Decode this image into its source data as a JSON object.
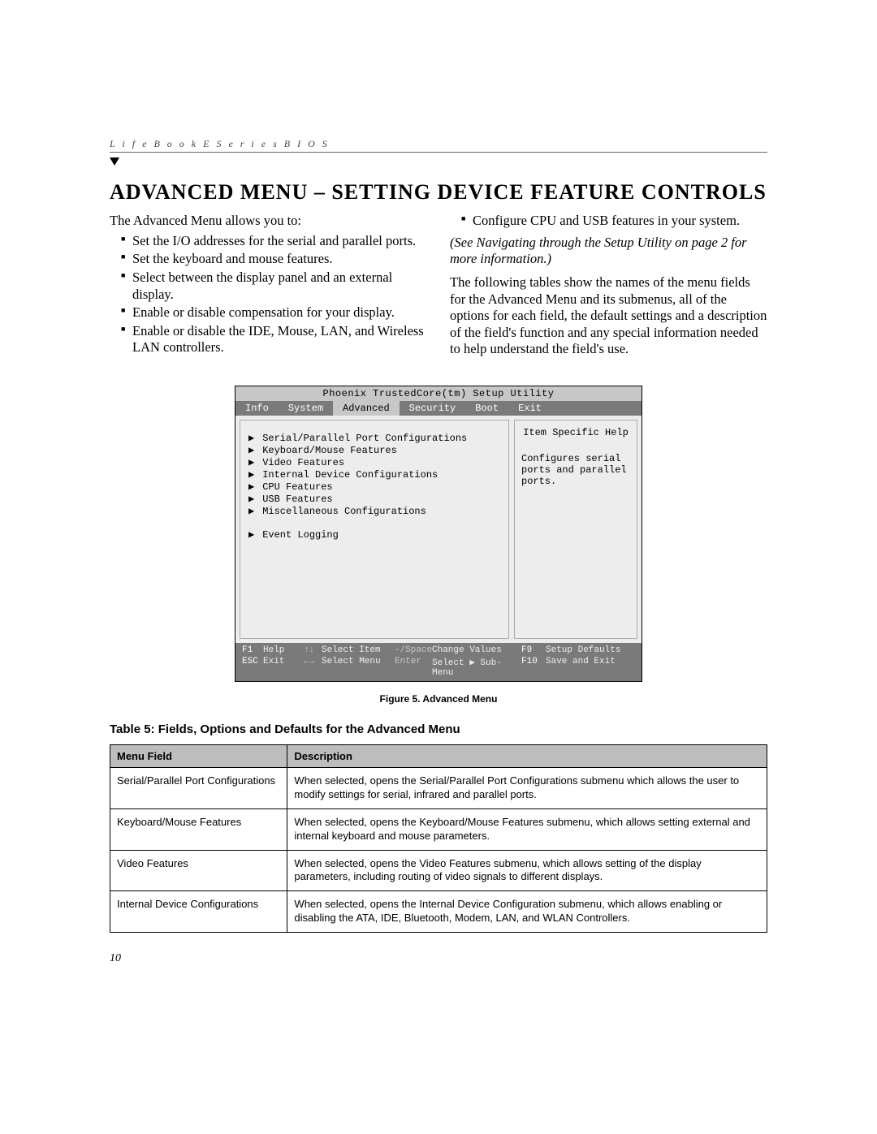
{
  "running_header": "L i f e B o o k   E   S e r i e s   B I O S",
  "page_number": "10",
  "section_title": "ADVANCED MENU – SETTING DEVICE FEATURE CONTROLS",
  "intro_left": "The Advanced Menu allows you to:",
  "bullets_left": [
    "Set the I/O addresses for the serial and parallel ports.",
    "Set the keyboard and mouse features.",
    "Select between the display panel and an external display.",
    "Enable or disable compensation for your display.",
    "Enable or disable the IDE, Mouse, LAN, and Wireless LAN controllers."
  ],
  "bullet_right": "Configure CPU and USB features in your system.",
  "italic_right": "(See Navigating through the Setup Utility on page 2 for more information.)",
  "para_right": "The following tables show the names of the menu fields for the Advanced Menu and its submenus, all of the options for each field, the default settings and a description of the field's function and any special information needed to help understand the field's use.",
  "bios": {
    "title": "Phoenix TrustedCore(tm) Setup Utility",
    "tabs": [
      "Info",
      "System",
      "Advanced",
      "Security",
      "Boot",
      "Exit"
    ],
    "active_tab": "Advanced",
    "items": [
      "Serial/Parallel Port Configurations",
      "Keyboard/Mouse Features",
      "Video Features",
      "Internal Device Configurations",
      "CPU Features",
      "USB Features",
      "Miscellaneous Configurations"
    ],
    "extra_item": "Event Logging",
    "help_title": "Item Specific Help",
    "help_text": "Configures serial ports and parallel ports.",
    "footer": {
      "r1": {
        "k1": "F1",
        "l1": "Help",
        "k2": "↑↓",
        "l2": "Select Item",
        "k3": "-/Space",
        "l3": "Change Values",
        "k4": "F9",
        "l4": "Setup Defaults"
      },
      "r2": {
        "k1": "ESC",
        "l1": "Exit",
        "k2": "←→",
        "l2": "Select Menu",
        "k3": "Enter",
        "l3": "Select ▶ Sub-Menu",
        "k4": "F10",
        "l4": "Save and Exit"
      }
    }
  },
  "figure_caption": "Figure 5.  Advanced Menu",
  "table_title": "Table 5: Fields, Options and Defaults for the Advanced Menu",
  "table": {
    "headers": [
      "Menu Field",
      "Description"
    ],
    "rows": [
      {
        "field": "Serial/Parallel Port Configurations",
        "desc": "When selected, opens the Serial/Parallel Port Configurations submenu which allows the user to modify settings for serial, infrared and parallel ports."
      },
      {
        "field": "Keyboard/Mouse Features",
        "desc": "When selected, opens the Keyboard/Mouse Features submenu, which allows setting external and internal keyboard and mouse parameters."
      },
      {
        "field": "Video Features",
        "desc": "When selected, opens the Video Features submenu, which allows setting of the display parameters, including routing of video signals to different displays."
      },
      {
        "field": "Internal Device Configurations",
        "desc": "When selected, opens the Internal Device Configuration submenu, which allows enabling or disabling the ATA, IDE, Bluetooth, Modem, LAN, and WLAN Controllers."
      }
    ]
  }
}
